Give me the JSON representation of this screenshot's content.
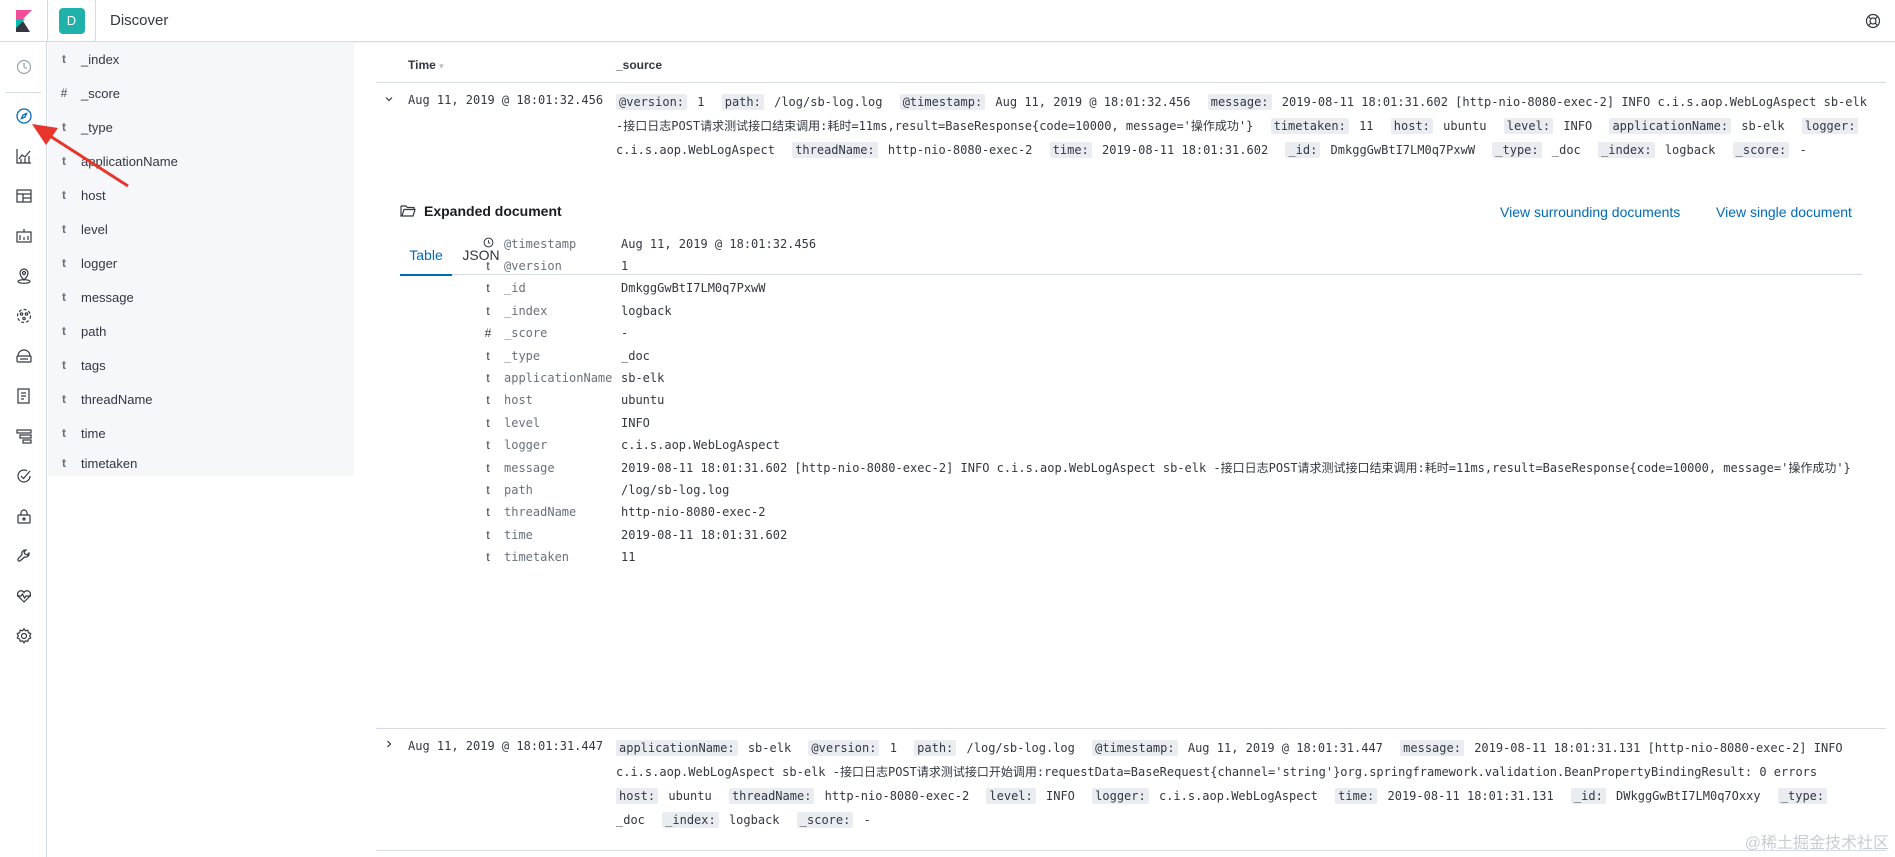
{
  "header": {
    "space_initial": "D",
    "page_title": "Discover"
  },
  "fields": [
    {
      "type": "t",
      "name": "_index"
    },
    {
      "type": "#",
      "name": "_score"
    },
    {
      "type": "t",
      "name": "_type"
    },
    {
      "type": "t",
      "name": "applicationName"
    },
    {
      "type": "t",
      "name": "host"
    },
    {
      "type": "t",
      "name": "level"
    },
    {
      "type": "t",
      "name": "logger"
    },
    {
      "type": "t",
      "name": "message"
    },
    {
      "type": "t",
      "name": "path"
    },
    {
      "type": "t",
      "name": "tags"
    },
    {
      "type": "t",
      "name": "threadName"
    },
    {
      "type": "t",
      "name": "time"
    },
    {
      "type": "t",
      "name": "timetaken"
    }
  ],
  "table": {
    "col_time": "Time",
    "col_source": "_source",
    "rows": [
      {
        "time": "Aug 11, 2019 @ 18:01:32.456",
        "expanded": true,
        "source": [
          {
            "k": "@version:",
            "v": "1"
          },
          {
            "k": "path:",
            "v": "/log/sb-log.log"
          },
          {
            "k": "@timestamp:",
            "v": "Aug 11, 2019 @ 18:01:32.456"
          },
          {
            "k": "message:",
            "v": "2019-08-11 18:01:31.602 [http-nio-8080-exec-2] INFO c.i.s.aop.WebLogAspect sb-elk -接口日志POST请求测试接口结束调用:耗时=11ms,result=BaseResponse{code=10000, message='操作成功'}"
          },
          {
            "k": "timetaken:",
            "v": "11"
          },
          {
            "k": "host:",
            "v": "ubuntu"
          },
          {
            "k": "level:",
            "v": "INFO"
          },
          {
            "k": "applicationName:",
            "v": "sb-elk"
          },
          {
            "k": "logger:",
            "v": "c.i.s.aop.WebLogAspect"
          },
          {
            "k": "threadName:",
            "v": "http-nio-8080-exec-2"
          },
          {
            "k": "time:",
            "v": "2019-08-11 18:01:31.602"
          },
          {
            "k": "_id:",
            "v": "DmkggGwBtI7LM0q7PxwW"
          },
          {
            "k": "_type:",
            "v": "_doc"
          },
          {
            "k": "_index:",
            "v": "logback"
          },
          {
            "k": "_score:",
            "v": "-"
          }
        ]
      },
      {
        "time": "Aug 11, 2019 @ 18:01:31.447",
        "expanded": false,
        "source": [
          {
            "k": "applicationName:",
            "v": "sb-elk"
          },
          {
            "k": "@version:",
            "v": "1"
          },
          {
            "k": "path:",
            "v": "/log/sb-log.log"
          },
          {
            "k": "@timestamp:",
            "v": "Aug 11, 2019 @ 18:01:31.447"
          },
          {
            "k": "message:",
            "v": "2019-08-11 18:01:31.131 [http-nio-8080-exec-2] INFO c.i.s.aop.WebLogAspect sb-elk -接口日志POST请求测试接口开始调用:requestData=BaseRequest{channel='string'}org.springframework.validation.BeanPropertyBindingResult: 0 errors"
          },
          {
            "k": "host:",
            "v": "ubuntu"
          },
          {
            "k": "threadName:",
            "v": "http-nio-8080-exec-2"
          },
          {
            "k": "level:",
            "v": "INFO"
          },
          {
            "k": "logger:",
            "v": "c.i.s.aop.WebLogAspect"
          },
          {
            "k": "time:",
            "v": "2019-08-11 18:01:31.131"
          },
          {
            "k": "_id:",
            "v": "DWkggGwBtI7LM0q7Oxxy"
          },
          {
            "k": "_type:",
            "v": "_doc"
          },
          {
            "k": "_index:",
            "v": "logback"
          },
          {
            "k": "_score:",
            "v": "-"
          }
        ]
      }
    ]
  },
  "expanded": {
    "title": "Expanded document",
    "link_surrounding": "View surrounding documents",
    "link_single": "View single document",
    "tab_table": "Table",
    "tab_json": "JSON",
    "entries": [
      {
        "type": "clock",
        "key": "@timestamp",
        "value": "Aug 11, 2019 @ 18:01:32.456"
      },
      {
        "type": "t",
        "key": "@version",
        "value": "1"
      },
      {
        "type": "t",
        "key": "_id",
        "value": "DmkggGwBtI7LM0q7PxwW"
      },
      {
        "type": "t",
        "key": "_index",
        "value": "logback"
      },
      {
        "type": "#",
        "key": "_score",
        "value": " -"
      },
      {
        "type": "t",
        "key": "_type",
        "value": "_doc"
      },
      {
        "type": "t",
        "key": "applicationName",
        "value": "sb-elk"
      },
      {
        "type": "t",
        "key": "host",
        "value": "ubuntu"
      },
      {
        "type": "t",
        "key": "level",
        "value": "INFO"
      },
      {
        "type": "t",
        "key": "logger",
        "value": "c.i.s.aop.WebLogAspect"
      },
      {
        "type": "t",
        "key": "message",
        "value": "2019-08-11 18:01:31.602 [http-nio-8080-exec-2] INFO  c.i.s.aop.WebLogAspect sb-elk -接口日志POST请求测试接口结束调用:耗时=11ms,result=BaseResponse{code=10000, message='操作成功'}"
      },
      {
        "type": "t",
        "key": "path",
        "value": "/log/sb-log.log"
      },
      {
        "type": "t",
        "key": "threadName",
        "value": "http-nio-8080-exec-2"
      },
      {
        "type": "t",
        "key": "time",
        "value": "2019-08-11 18:01:31.602"
      },
      {
        "type": "t",
        "key": "timetaken",
        "value": "11"
      }
    ]
  },
  "nav_icons": [
    "recent-icon",
    "discover-icon",
    "visualize-icon",
    "dashboard-icon",
    "canvas-icon",
    "maps-icon",
    "ml-icon",
    "infrastructure-icon",
    "logs-icon",
    "apm-icon",
    "uptime-icon",
    "siem-icon",
    "dev-tools-icon",
    "monitoring-icon",
    "management-icon"
  ],
  "watermark": "@稀土掘金技术社区",
  "colors": {
    "accent": "#006bb4",
    "space": "#20b2aa",
    "annotation_arrow": "#e8352b"
  }
}
